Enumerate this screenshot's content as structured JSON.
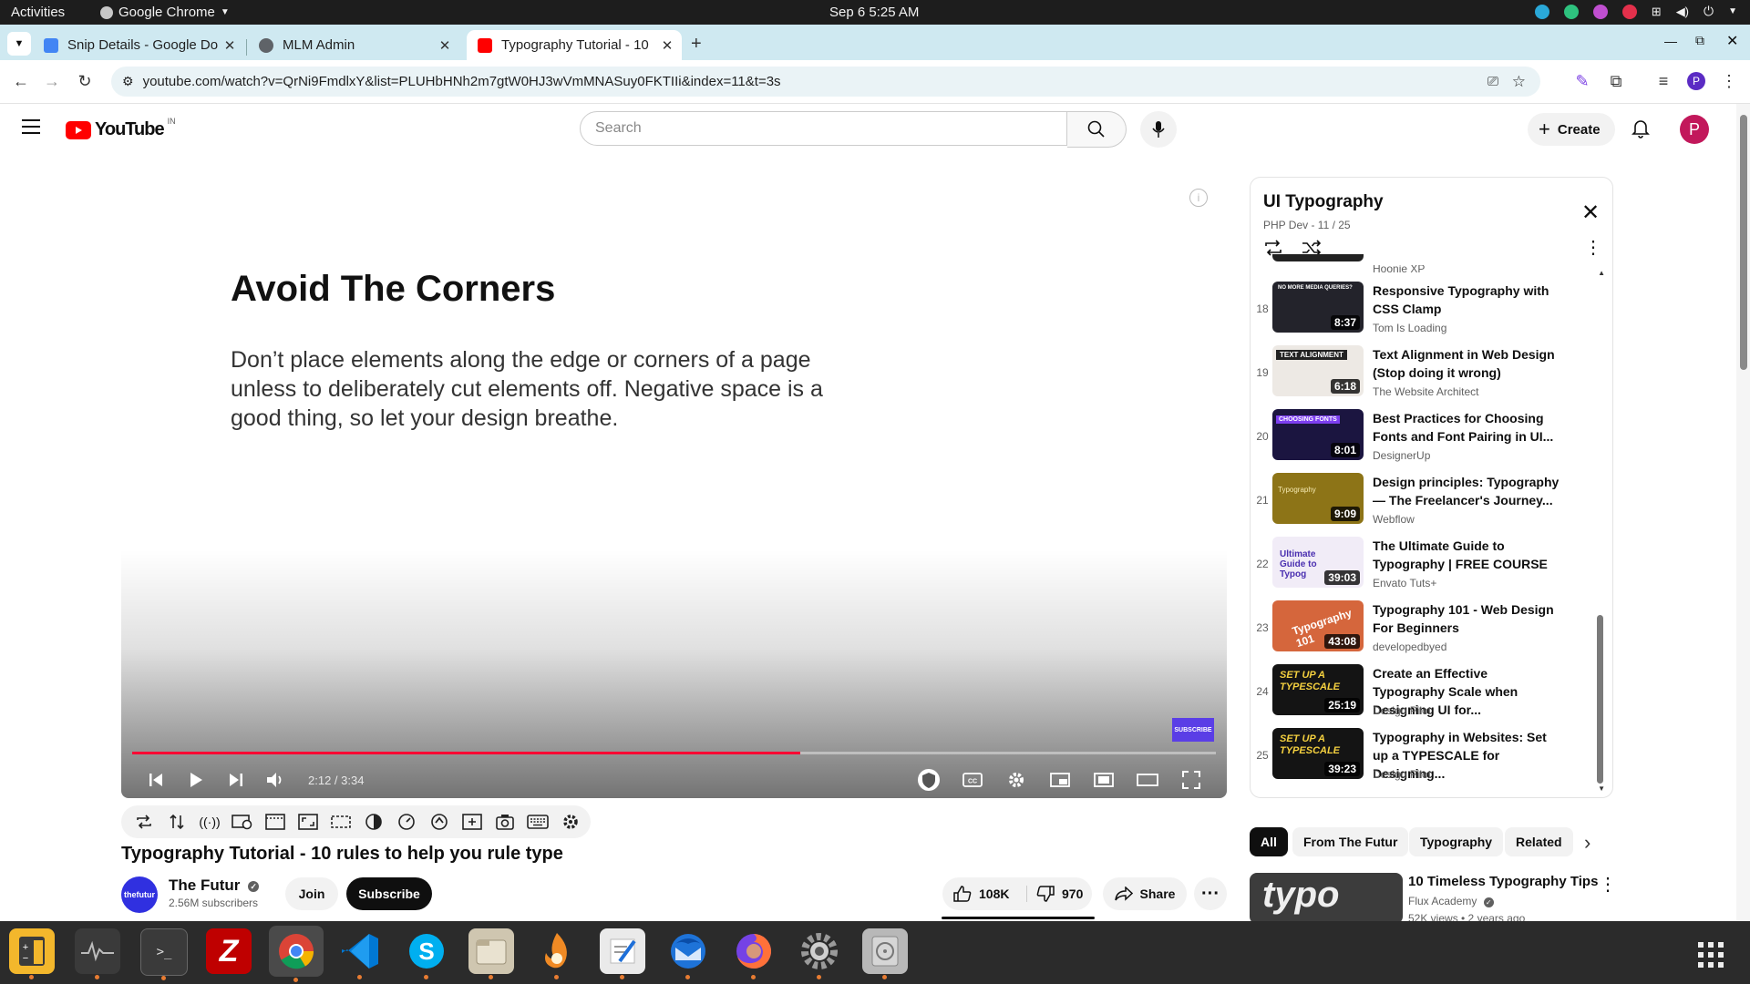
{
  "system_bar": {
    "activities": "Activities",
    "app_name": "Google Chrome",
    "clock": "Sep 6  5:25 AM"
  },
  "browser": {
    "tabs": [
      {
        "label": "Snip Details - Google Do",
        "favicon_color": "#4285f4",
        "active": false
      },
      {
        "label": "MLM Admin",
        "favicon_color": "#5f6368",
        "active": false
      },
      {
        "label": "Typography Tutorial - 10",
        "favicon_color": "#ff0000",
        "active": true
      }
    ],
    "url": "youtube.com/watch?v=QrNi9FmdlxY&list=PLUHbHNh2m7gtW0HJ3wVmMNASuy0FKTIIi&index=11&t=3s",
    "profile_initial": "P"
  },
  "youtube": {
    "logo_text": "YouTube",
    "region": "IN",
    "search_placeholder": "Search",
    "create_label": "Create",
    "avatar_initial": "P",
    "accent": "#ff0000"
  },
  "video": {
    "slide_title": "Avoid The Corners",
    "slide_body": "Don’t place elements along the edge or corners of a page unless to deliberately cut elements off. Negative space is a good thing, so let your design breathe.",
    "time": "2:12 / 3:34",
    "progress": 0.6167,
    "watermark": "SUBSCRIBE",
    "title": "Typography Tutorial - 10 rules to help you rule type",
    "channel": "The Futur",
    "channel_avatar_text": "thefutur",
    "subscribers": "2.56M subscribers",
    "join_label": "Join",
    "subscribe_label": "Subscribe",
    "likes": "108K",
    "dislikes": "970",
    "share_label": "Share"
  },
  "playlist": {
    "title": "UI Typography",
    "meta": "PHP Dev - 11 / 25",
    "partial_channel": "Hoonie XP",
    "items": [
      {
        "num": "18",
        "title": "Responsive Typography with CSS Clamp",
        "channel": "Tom Is Loading",
        "duration": "8:37",
        "thumb_color": "#23232b",
        "thumb_text": "NO MORE MEDIA QUERIES?"
      },
      {
        "num": "19",
        "title": "Text Alignment in Web Design (Stop doing it wrong)",
        "channel": "The Website Architect",
        "duration": "6:18",
        "thumb_color": "#ede9e4",
        "thumb_text": "TEXT ALIGNMENT"
      },
      {
        "num": "20",
        "title": "Best Practices for Choosing Fonts and Font Pairing in UI...",
        "channel": "DesignerUp",
        "duration": "8:01",
        "thumb_color": "#1b1540",
        "thumb_text": "CHOOSING FONTS"
      },
      {
        "num": "21",
        "title": "Design principles: Typography — The Freelancer's Journey...",
        "channel": "Webflow",
        "duration": "9:09",
        "thumb_color": "#8d7417",
        "thumb_text": "Typography"
      },
      {
        "num": "22",
        "title": "The Ultimate Guide to Typography | FREE COURSE",
        "channel": "Envato Tuts+",
        "duration": "39:03",
        "thumb_color": "#f1ecf7",
        "thumb_text": "Ultimate Guide to Typog"
      },
      {
        "num": "23",
        "title": "Typography 101 - Web Design For Beginners",
        "channel": "developedbyed",
        "duration": "43:08",
        "thumb_color": "#d5663c",
        "thumb_text": "Typography 101"
      },
      {
        "num": "24",
        "title": "Create an Effective Typography Scale when Designing UI for...",
        "channel": "Design Pilot",
        "duration": "25:19",
        "thumb_color": "#141414",
        "thumb_text": "SET UP A TYPESCALE"
      },
      {
        "num": "25",
        "title": "Typography in Websites: Set up a TYPESCALE for Designing...",
        "channel": "Design Pilot",
        "duration": "39:23",
        "thumb_color": "#141414",
        "thumb_text": "SET UP A TYPESCALE"
      }
    ]
  },
  "chips": [
    "All",
    "From The Futur",
    "Typography",
    "Related"
  ],
  "recommendation": {
    "title": "10 Timeless Typography Tips",
    "channel": "Flux Academy",
    "meta": "52K views • 2 years ago",
    "thumb_text": "typo"
  },
  "dock": {
    "apps": [
      {
        "name": "calculator-app-icon",
        "color": "#f3b72c"
      },
      {
        "name": "system-monitor-app-icon",
        "color": "#3a3a3a"
      },
      {
        "name": "terminal-app-icon",
        "color": "#3a3a3a"
      },
      {
        "name": "filezilla-app-icon",
        "color": "#bf0000"
      },
      {
        "name": "chrome-app-icon",
        "color": "#4a4a4a"
      },
      {
        "name": "vscode-app-icon",
        "color": "#2b2b2b"
      },
      {
        "name": "skype-app-icon",
        "color": "#00aff0"
      },
      {
        "name": "files-app-icon",
        "color": "#cfc6b0"
      },
      {
        "name": "blender-app-icon",
        "color": "#f08a24"
      },
      {
        "name": "text-editor-app-icon",
        "color": "#eaeaea"
      },
      {
        "name": "thunderbird-app-icon",
        "color": "#1e73d8"
      },
      {
        "name": "firefox-app-icon",
        "color": "#ff7139"
      },
      {
        "name": "settings-app-icon",
        "color": "#9a9a9a"
      },
      {
        "name": "disks-app-icon",
        "color": "#b8b8b8"
      }
    ]
  }
}
